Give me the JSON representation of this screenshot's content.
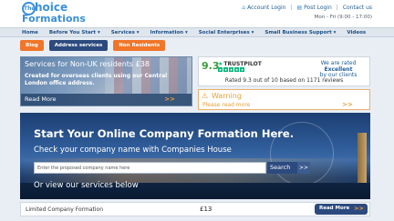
{
  "brand": {
    "logo_the": "The",
    "logo_choice": "hoice",
    "logo_formations": "Formations"
  },
  "top_links": [
    {
      "label": "Account Login",
      "icon": "home-icon"
    },
    {
      "label": "Post Login",
      "icon": "document-icon"
    },
    {
      "label": "Contact us",
      "icon": "phone-icon"
    }
  ],
  "hours": "Mon - Fri (9:00 - 17:00)",
  "nav": [
    "Home",
    "Before You Start ▾",
    "Services ▾",
    "Information ▾",
    "Social Enterprises ▾",
    "Small Business Support ▾",
    "Videos"
  ],
  "pills": [
    {
      "label": "Blog",
      "color": "#f0762a"
    },
    {
      "label": "Address services",
      "color": "#2c4a7e"
    },
    {
      "label": "Non Residents",
      "color": "#f0762a"
    }
  ],
  "promo": {
    "title": "Services for Non-UK residents £38",
    "text": "Created for overseas clients using our Central London office address.",
    "read_more": "Read More",
    "arrow": ">>"
  },
  "rating": {
    "score": "9.3",
    "brand": "TRUSTPILOT",
    "stars": 5,
    "line1": "We are rated",
    "line2": "Excellent",
    "line3": "by our clients",
    "summary": "Rated 9.3 out of 10 based on 1171 reviews"
  },
  "warning": {
    "title": "Warning",
    "read_more": "Please read more",
    "arrow": ">>"
  },
  "hero": {
    "title": "Start Your Online Company Formation Here.",
    "subtitle": "Check your company name with Companies House",
    "placeholder": "Enter the proposed company name here",
    "search_label": "Search",
    "search_arrow": ">>",
    "services_text": "Or view our services below"
  },
  "row": {
    "label": "Limited Company Formation",
    "price": "£13",
    "button": "Read More",
    "arrow": ">>"
  },
  "colors": {
    "accent": "#3b8fd9",
    "navy": "#2c4a7e",
    "orange": "#f0762a",
    "trustpilot": "#00b67a"
  }
}
